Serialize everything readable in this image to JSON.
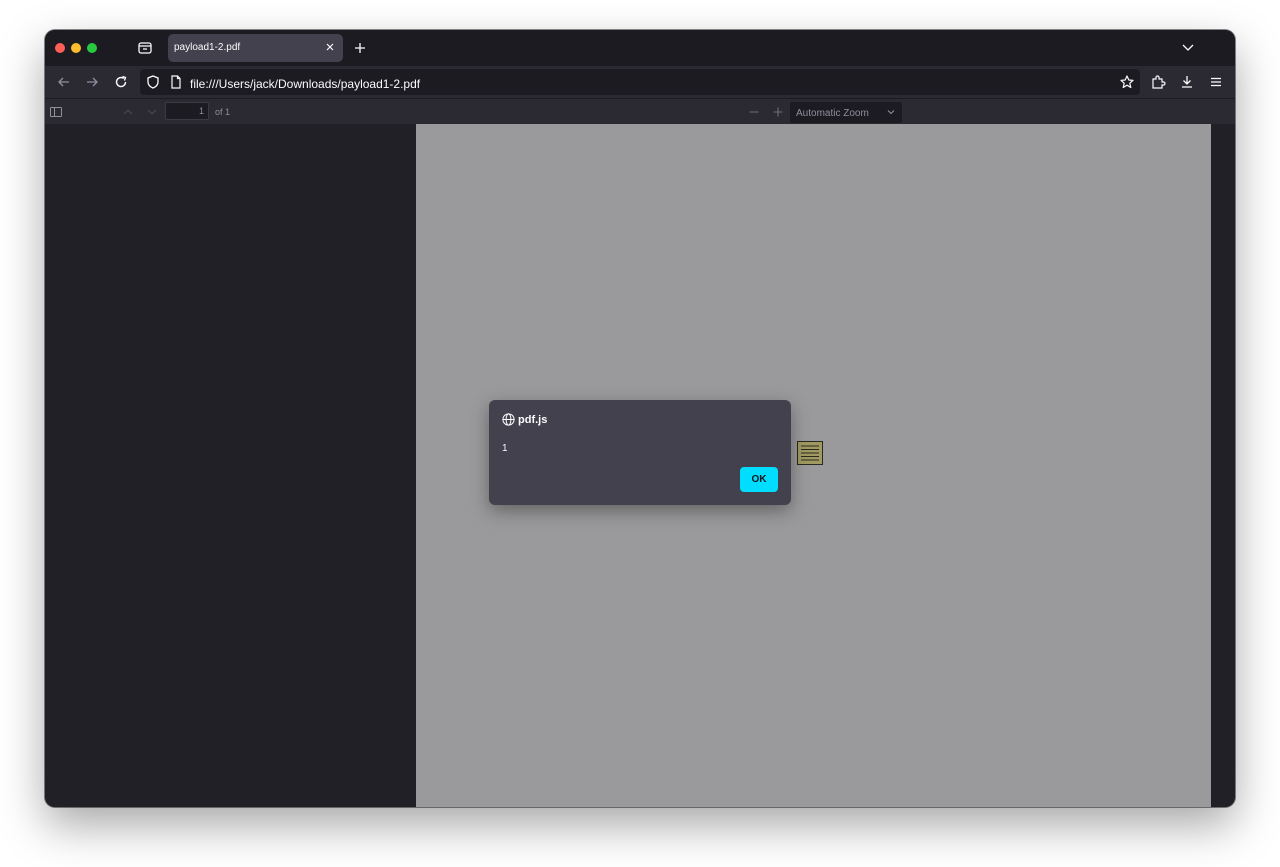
{
  "tab": {
    "title": "payload1-2.pdf"
  },
  "url": {
    "text": "file:///Users/jack/Downloads/payload1-2.pdf"
  },
  "pdf_toolbar": {
    "page_number": "1",
    "page_count_label": "of 1",
    "zoom_label": "Automatic Zoom"
  },
  "dialog": {
    "title": "pdf.js",
    "message": "1",
    "ok_label": "OK"
  },
  "colors": {
    "accent": "#00ddff",
    "viewer_bg": "#9a9a9c",
    "chrome_bg": "#2b2a33"
  }
}
